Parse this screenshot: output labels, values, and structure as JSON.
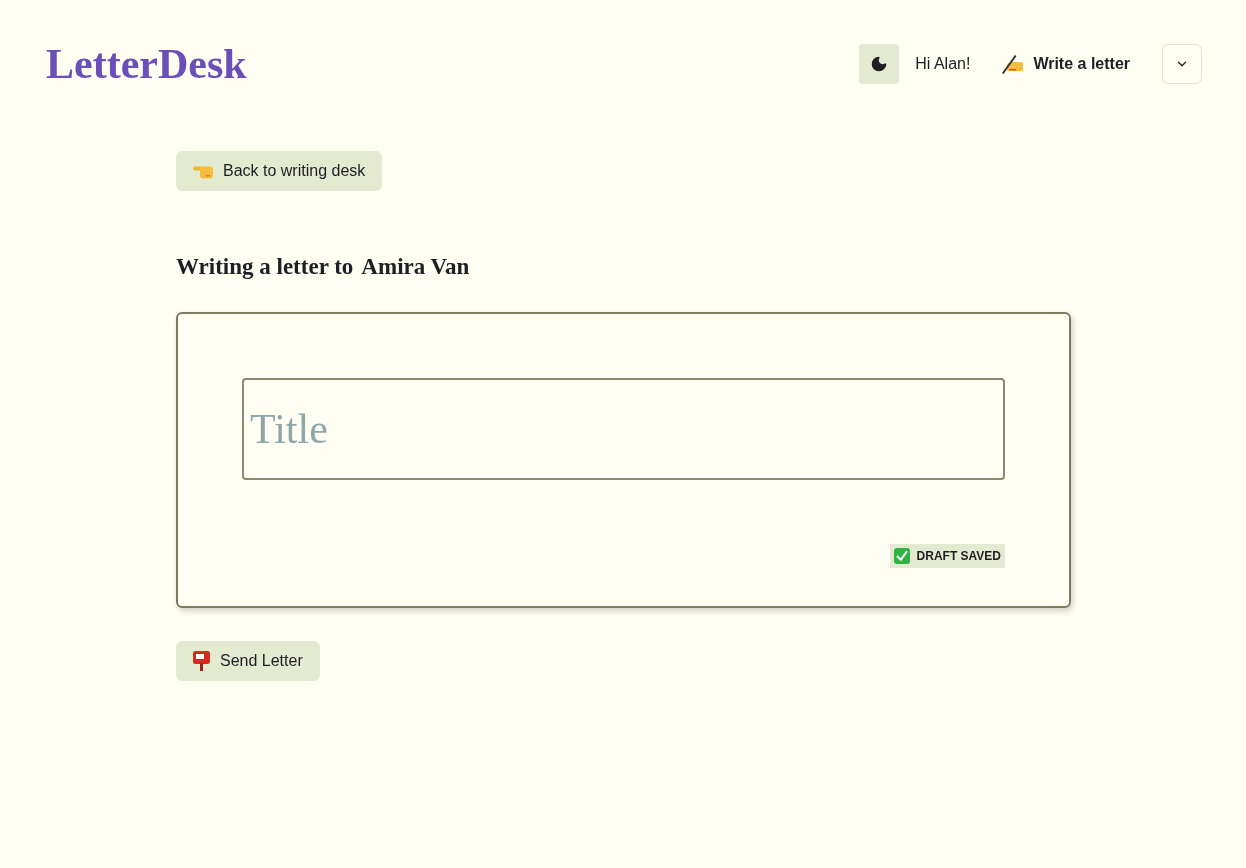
{
  "header": {
    "logo": "LetterDesk",
    "greeting": "Hi Alan!",
    "write_link": "Write a letter"
  },
  "back_button": "Back to writing desk",
  "heading": {
    "prefix": "Writing a letter to",
    "recipient": "Amira Van"
  },
  "letter": {
    "title_field": {
      "placeholder": "Title"
    },
    "status": "DRAFT SAVED"
  },
  "send_button": "Send Letter"
}
